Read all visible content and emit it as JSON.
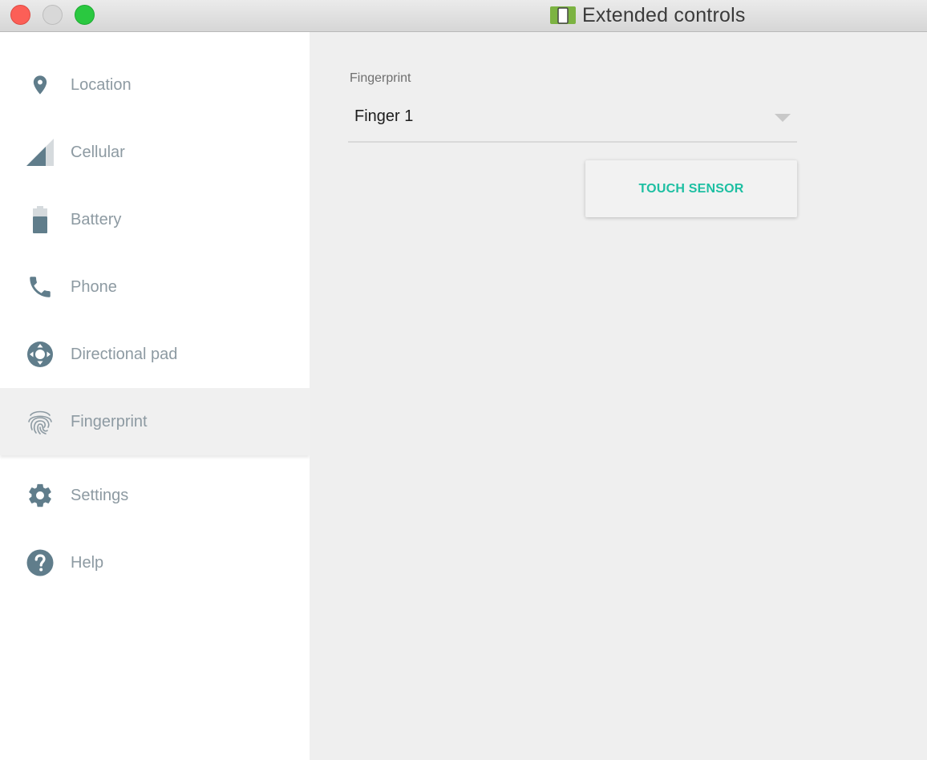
{
  "window": {
    "title": "Extended controls",
    "controls": [
      "close",
      "minimize",
      "zoom"
    ]
  },
  "sidebar": {
    "items": [
      {
        "label": "Location",
        "icon": "location-pin-icon"
      },
      {
        "label": "Cellular",
        "icon": "cellular-signal-icon"
      },
      {
        "label": "Battery",
        "icon": "battery-icon"
      },
      {
        "label": "Phone",
        "icon": "phone-icon"
      },
      {
        "label": "Directional pad",
        "icon": "dpad-icon"
      },
      {
        "label": "Fingerprint",
        "icon": "fingerprint-icon",
        "selected": true
      },
      {
        "label": "Settings",
        "icon": "gear-icon"
      },
      {
        "label": "Help",
        "icon": "help-icon"
      }
    ]
  },
  "main": {
    "fingerprint_label": "Fingerprint",
    "selected_finger": "Finger 1",
    "touch_button_label": "TOUCH SENSOR"
  },
  "colors": {
    "icon": "#607d8b",
    "label": "#8d9aa2",
    "accent": "#1dbfa2",
    "app_icon": "#7cb342"
  }
}
